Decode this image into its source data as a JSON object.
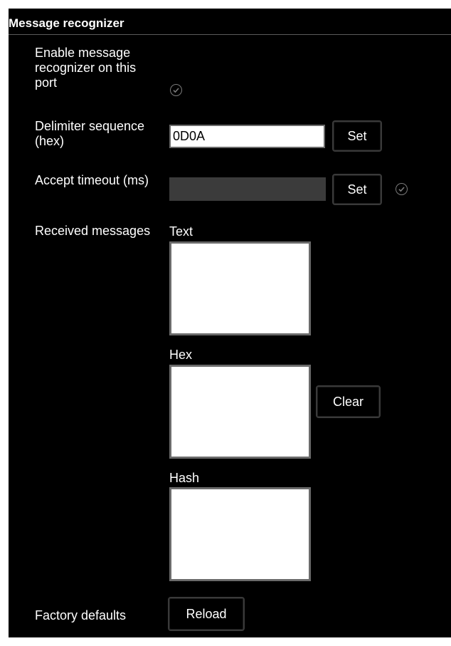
{
  "section": {
    "title": "Message recognizer"
  },
  "enable": {
    "label": "Enable message recognizer on this port"
  },
  "delimiter": {
    "label": "Delimiter sequence (hex)",
    "value": "0D0A",
    "set_label": "Set"
  },
  "timeout": {
    "label": "Accept timeout (ms)",
    "value": "",
    "set_label": "Set"
  },
  "received": {
    "label": "Received messages",
    "text_caption": "Text",
    "hex_caption": "Hex",
    "hash_caption": "Hash",
    "text_value": "",
    "hex_value": "",
    "hash_value": "",
    "clear_label": "Clear"
  },
  "factory": {
    "label": "Factory defaults",
    "reload_label": "Reload"
  },
  "colors": {
    "panel_bg": "#000000",
    "text": "#ffffff",
    "input_border": "#6a6a6a",
    "disabled_input": "#3b3b3b",
    "check_icon": "#7a7a7a"
  },
  "icons": [
    "check-circle-icon"
  ]
}
